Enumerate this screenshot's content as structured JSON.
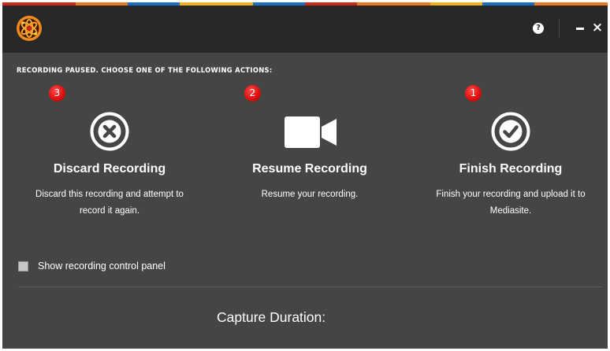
{
  "window": {
    "top_strip_colors": [
      "#c9281c",
      "#e8771d",
      "#1a6fc2",
      "#f2b31a",
      "#1a6fc2",
      "#c9281c",
      "#e8771d",
      "#f2b31a",
      "#1a6fc2",
      "#e8771d"
    ],
    "titlebar_color": "#282828",
    "body_color": "#454545"
  },
  "titlebar": {
    "logo_icon": "mediasite-logo-icon",
    "help_label": "?",
    "minimize_icon": "minimize-icon",
    "close_label": "×"
  },
  "instruction": "RECORDING PAUSED. CHOOSE ONE OF THE FOLLOWING ACTIONS:",
  "actions": [
    {
      "badge": "3",
      "icon": "x-circle-icon",
      "title": "Discard Recording",
      "desc": "Discard this recording and attempt to record it again."
    },
    {
      "badge": "2",
      "icon": "video-camera-icon",
      "title": "Resume Recording",
      "desc": "Resume your recording."
    },
    {
      "badge": "1",
      "icon": "check-circle-icon",
      "title": "Finish Recording",
      "desc": "Finish your recording and upload it to Mediasite."
    }
  ],
  "show_control_panel": {
    "label": "Show recording control panel",
    "checked": false
  },
  "capture_duration": {
    "label": "Capture Duration:"
  },
  "accent_badge_color": "#e01010"
}
